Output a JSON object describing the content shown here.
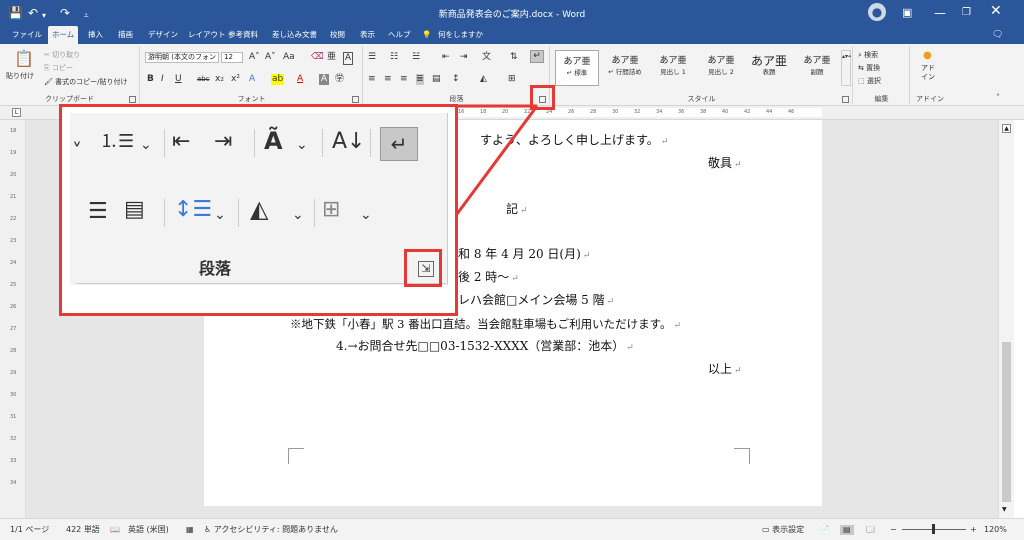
{
  "window": {
    "title": "新商品発表会のご案内.docx - Word",
    "qat_icons": [
      "save-icon",
      "undo-icon",
      "redo-icon",
      "customize-icon"
    ],
    "controls": [
      "account-icon",
      "ribbon-display-icon",
      "minimize-icon",
      "restore-icon",
      "close-icon"
    ]
  },
  "tabs": [
    "ファイル",
    "ホーム",
    "挿入",
    "描画",
    "デザイン",
    "レイアウト",
    "参考資料",
    "差し込み文書",
    "校閲",
    "表示",
    "ヘルプ"
  ],
  "active_tab": "ホーム",
  "tell_me": "何をしますか",
  "ribbon": {
    "clipboard": {
      "label": "クリップボード",
      "paste": "貼り付け",
      "cut": "切り取り",
      "copy": "コピー",
      "format_painter": "書式のコピー/貼り付け"
    },
    "font": {
      "label": "フォント",
      "name": "游明朝 (本文のフォン",
      "size": "12"
    },
    "paragraph": {
      "label": "段落"
    },
    "styles": {
      "label": "スタイル",
      "items": [
        {
          "preview": "あア亜",
          "name": "標準"
        },
        {
          "preview": "あア亜",
          "name": "行間詰め"
        },
        {
          "preview": "あア亜",
          "name": "見出し 1"
        },
        {
          "preview": "あア亜",
          "name": "見出し 2"
        },
        {
          "preview": "あア亜",
          "name": "表題"
        },
        {
          "preview": "あア亜",
          "name": "副題"
        }
      ]
    },
    "editing": {
      "label": "編集",
      "find": "検索",
      "replace": "置換",
      "select": "選択"
    },
    "addins": {
      "label": "アドイン",
      "button": "アド\nイン"
    }
  },
  "ruler": {
    "h_ticks": [
      "16",
      "18",
      "20",
      "22",
      "24",
      "26",
      "28",
      "30",
      "32",
      "34",
      "36",
      "38",
      "40",
      "42",
      "44",
      "46"
    ],
    "v_ticks": [
      "18",
      "19",
      "20",
      "21",
      "22",
      "23",
      "24",
      "25",
      "26",
      "27",
      "28",
      "29",
      "30",
      "31",
      "32",
      "33",
      "34"
    ]
  },
  "document": {
    "lines": [
      {
        "text": "すよう、よろしく申し上げます。"
      },
      {
        "text": "敬具"
      },
      {
        "text": "記"
      },
      {
        "text": "和 8 年 4 月 20 日(月)"
      },
      {
        "text": "後 2 時～"
      },
      {
        "text": "レハ会館□メイン会場 5 階"
      },
      {
        "text": "※地下鉄「小春」駅 3 番出口直結。当会館駐車場もご利用いただけます。"
      },
      {
        "text": "4.→お問合せ先□□03-1532-XXXX（営業部：池本）"
      },
      {
        "text": "以上"
      }
    ]
  },
  "callout": {
    "group_label": "段落",
    "highlight_color": "#e53935"
  },
  "status": {
    "page": "1/1 ページ",
    "words": "422 単語",
    "language": "英語 (米国)",
    "accessibility": "アクセシビリティ: 問題ありません",
    "display_settings": "表示設定",
    "zoom": "120%"
  },
  "colors": {
    "brand": "#2b579a",
    "highlight": "#e53935"
  }
}
